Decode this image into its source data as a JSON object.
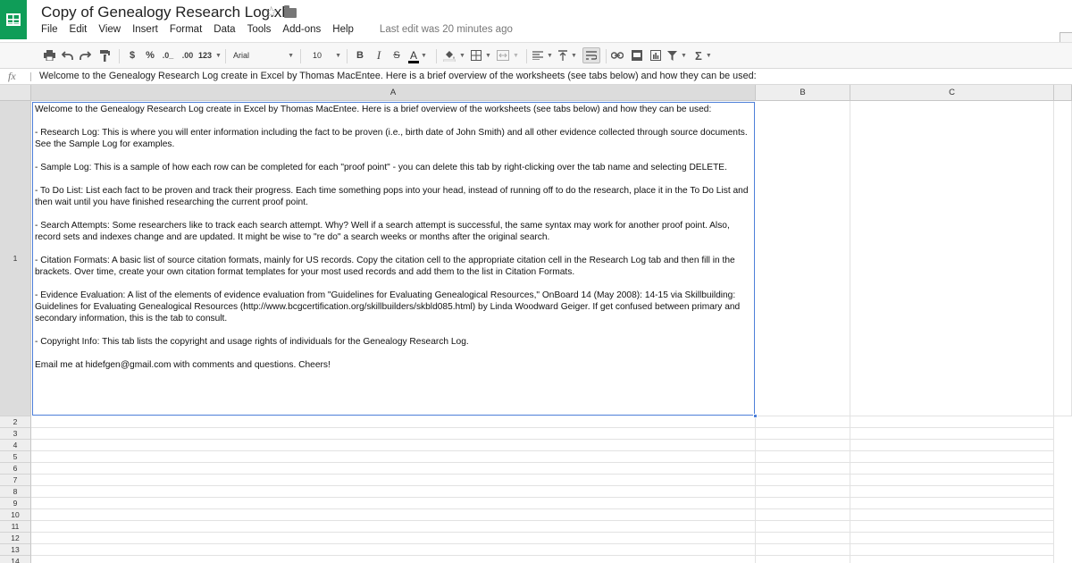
{
  "header": {
    "title": "Copy of Genealogy Research Log.xls",
    "star_icon": "☆",
    "last_edit": "Last edit was 20 minutes ago"
  },
  "menu": [
    "File",
    "Edit",
    "View",
    "Insert",
    "Format",
    "Data",
    "Tools",
    "Add-ons",
    "Help"
  ],
  "toolbar": {
    "currency": "$",
    "percent": "%",
    "decrease_decimal": ".0_",
    "increase_decimal": ".00",
    "number_format": "123",
    "font": "Arial",
    "font_size": "10",
    "bold": "B",
    "italic": "I",
    "strike": "S",
    "text_color": "A",
    "functions": "Σ"
  },
  "formula_bar": {
    "fx_label": "fx",
    "content": "Welcome to the Genealogy Research Log create in Excel by Thomas MacEntee. Here is a brief overview of the worksheets (see tabs below) and how they can be used:"
  },
  "columns": [
    "A",
    "B",
    "C"
  ],
  "rows": [
    "1",
    "2",
    "3",
    "4",
    "5",
    "6",
    "7",
    "8",
    "9",
    "10",
    "11",
    "12",
    "13",
    "14"
  ],
  "cell_a1": {
    "paragraphs": [
      "Welcome to the Genealogy Research Log create in Excel by Thomas MacEntee. Here is a brief overview of the worksheets (see tabs below) and how they can be used:",
      "- Research Log: This is where you will enter information including the fact to be proven (i.e., birth date of John Smith) and all other evidence collected through source documents. See the Sample Log for examples.",
      "- Sample Log: This is a sample of how each row can be completed for each \"proof point\" - you can delete this tab by right-clicking over the tab name and selecting DELETE.",
      "- To Do List: List each fact to be proven and track their progress. Each time something pops into your head, instead of running off to do the research, place it in the To Do List and then wait until you have finished researching the current proof point.",
      "- Search Attempts: Some researchers like to track each search attempt. Why? Well if a search attempt is successful, the same syntax may work for another proof point. Also, record sets and indexes change and are updated. It might be wise to \"re do\" a search weeks or months after the original search.",
      "- Citation Formats: A basic list of source citation formats, mainly for US records. Copy the citation cell to the appropriate citation cell in the Research Log tab and then fill in the brackets. Over time, create your own citation format templates for your most used records and add them to the list in Citation Formats.",
      "- Evidence Evaluation: A list of the elements of evidence evaluation from \"Guidelines for Evaluating Genealogical Resources,\" OnBoard 14 (May 2008): 14-15 via Skillbuilding: Guidelines for Evaluating Genealogical Resources (http://www.bcgcertification.org/skillbuilders/skbld085.html) by Linda Woodward Geiger. If get confused between primary and secondary  information, this is the tab to consult.",
      "- Copyright Info: This tab lists the copyright and usage rights of individuals for the Genealogy Research Log.",
      "Email me at hidefgen@gmail.com with comments and questions. Cheers!"
    ]
  }
}
